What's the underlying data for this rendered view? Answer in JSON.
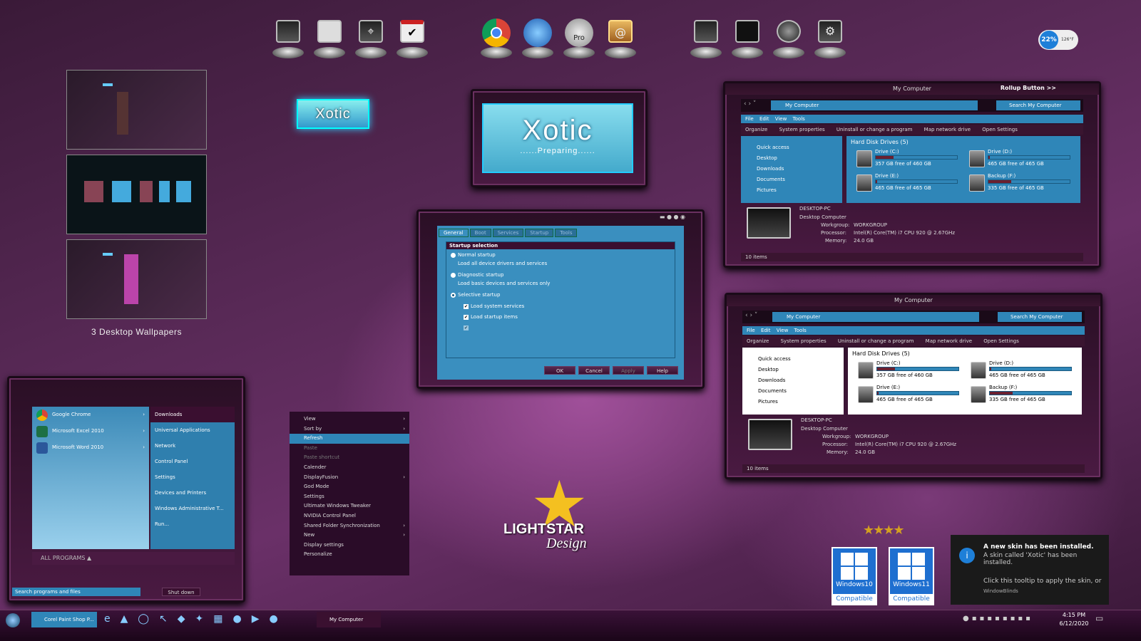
{
  "dock": {
    "group1": [
      "monitor-icon",
      "clipboard-icon",
      "satellite-icon",
      "calendar-check-icon"
    ],
    "group2": [
      "chrome-icon",
      "thunderbird-icon",
      "pro-icon",
      "contacts-icon"
    ],
    "group3": [
      "settings-monitor-icon",
      "terminal-icon",
      "wheel-icon",
      "gear-monitor-icon"
    ],
    "pro_label": "Pro"
  },
  "weather": {
    "percent": "22%",
    "temp": "126°F"
  },
  "wallpapers": {
    "caption": "3 Desktop Wallpapers"
  },
  "xotic_small": "Xotic",
  "xotic_big": {
    "title": "Xotic",
    "subtitle": "......Preparing......"
  },
  "dialog": {
    "tabs": [
      "General",
      "Boot",
      "Services",
      "Startup",
      "Tools"
    ],
    "group": "Startup selection",
    "normal": "Normal startup",
    "normal_desc": "Load all device drivers and services",
    "diag": "Diagnostic startup",
    "diag_desc": "Load basic devices and services only",
    "selective": "Selective startup",
    "load_sys": "Load system services",
    "load_startup": "Load startup items",
    "buttons": [
      "OK",
      "Cancel",
      "Apply",
      "Help"
    ]
  },
  "explorer1": {
    "title": "My Computer",
    "rollup": "Rollup Button >>",
    "address": "My Computer",
    "search": "Search My Computer",
    "menu": "File  Edit  View  Tools",
    "cmd": [
      "Organize",
      "System properties",
      "Uninstall or change a program",
      "Map network drive",
      "Open Settings"
    ],
    "nav": [
      "Quick access",
      "Desktop",
      "Downloads",
      "Documents",
      "Pictures"
    ],
    "section": "Hard Disk Drives (5)",
    "drives": [
      {
        "name": "Drive (C:)",
        "free": "357 GB free of 460 GB",
        "used": 0.22
      },
      {
        "name": "Drive (D:)",
        "free": "465 GB free of 465 GB",
        "used": 0.02
      },
      {
        "name": "Drive (E:)",
        "free": "465 GB free of 465 GB",
        "used": 0.02
      },
      {
        "name": "Backup (F:)",
        "free": "335 GB free of 465 GB",
        "used": 0.28
      }
    ],
    "pc": "DESKTOP-PC",
    "pc_type": "Desktop Computer",
    "wg_l": "Workgroup:",
    "wg": "WORKGROUP",
    "proc_l": "Processor:",
    "proc": "Intel(R) Core(TM) i7 CPU       920  @ 2.67GHz",
    "mem_l": "Memory:",
    "mem": "24.0 GB",
    "status": "10 items"
  },
  "start": {
    "pinned": [
      "Google Chrome",
      "Microsoft Excel 2010",
      "Microsoft Word 2010"
    ],
    "right": [
      "Downloads",
      "Universal Applications",
      "Network",
      "Control Panel",
      "Settings",
      "Devices and Printers",
      "Windows Administrative T...",
      "Run..."
    ],
    "all": "ALL PROGRAMS",
    "search": "Search programs and files",
    "shutdown": "Shut down"
  },
  "ctx": [
    "View",
    "Sort by",
    "Refresh",
    "Paste",
    "Paste shortcut",
    "Calender",
    "DisplayFusion",
    "God Mode",
    "Settings",
    "Ultimate Windows Tweaker",
    "NVIDIA Control Panel",
    "Shared Folder Synchronization",
    "New",
    "Display settings",
    "Personalize"
  ],
  "logo": {
    "a": "LIGHTSTAR",
    "b": "Design"
  },
  "badges": [
    {
      "name": "Windows10",
      "cmp": "Compatible"
    },
    {
      "name": "Windows11",
      "cmp": "Compatible"
    }
  ],
  "toast": {
    "title": "A new skin has been installed.",
    "body": "A skin called 'Xotic' has been installed.",
    "hint": "Click this tooltip to apply the skin, or",
    "app": "WindowBlinds"
  },
  "taskbar": {
    "app1": "Corel Paint Shop P...",
    "app2": "My Computer",
    "time": "4:15 PM",
    "date": "6/12/2020"
  }
}
